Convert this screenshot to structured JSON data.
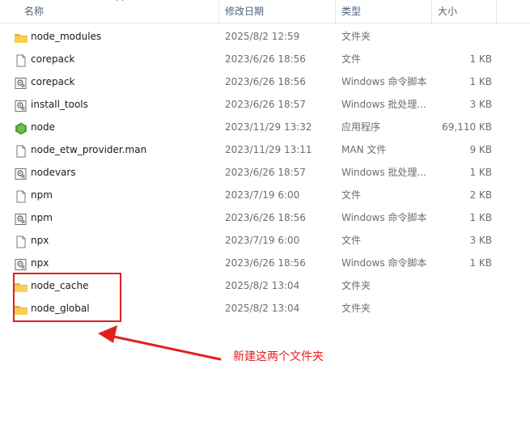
{
  "columns": {
    "name": "名称",
    "date": "修改日期",
    "type": "类型",
    "size": "大小"
  },
  "files": [
    {
      "icon": "folder-icon",
      "name": "node_modules",
      "date": "2025/8/2 12:59",
      "type": "文件夹",
      "size": ""
    },
    {
      "icon": "file-icon",
      "name": "corepack",
      "date": "2023/6/26 18:56",
      "type": "文件",
      "size": "1 KB"
    },
    {
      "icon": "cmd-script-icon",
      "name": "corepack",
      "date": "2023/6/26 18:56",
      "type": "Windows 命令脚本",
      "size": "1 KB"
    },
    {
      "icon": "batch-file-icon",
      "name": "install_tools",
      "date": "2023/6/26 18:57",
      "type": "Windows 批处理...",
      "size": "3 KB"
    },
    {
      "icon": "node-app-icon",
      "name": "node",
      "date": "2023/11/29 13:32",
      "type": "应用程序",
      "size": "69,110 KB"
    },
    {
      "icon": "file-icon",
      "name": "node_etw_provider.man",
      "date": "2023/11/29 13:11",
      "type": "MAN 文件",
      "size": "9 KB"
    },
    {
      "icon": "batch-file-icon",
      "name": "nodevars",
      "date": "2023/6/26 18:57",
      "type": "Windows 批处理...",
      "size": "1 KB"
    },
    {
      "icon": "file-icon",
      "name": "npm",
      "date": "2023/7/19 6:00",
      "type": "文件",
      "size": "2 KB"
    },
    {
      "icon": "cmd-script-icon",
      "name": "npm",
      "date": "2023/6/26 18:56",
      "type": "Windows 命令脚本",
      "size": "1 KB"
    },
    {
      "icon": "file-icon",
      "name": "npx",
      "date": "2023/7/19 6:00",
      "type": "文件",
      "size": "3 KB"
    },
    {
      "icon": "cmd-script-icon",
      "name": "npx",
      "date": "2023/6/26 18:56",
      "type": "Windows 命令脚本",
      "size": "1 KB"
    },
    {
      "icon": "folder-icon",
      "name": "node_cache",
      "date": "2025/8/2 13:04",
      "type": "文件夹",
      "size": ""
    },
    {
      "icon": "folder-icon",
      "name": "node_global",
      "date": "2025/8/2 13:04",
      "type": "文件夹",
      "size": ""
    }
  ],
  "annotation": {
    "text": "新建这两个文件夹",
    "color": "#e02020"
  },
  "colors": {
    "folder": "#f4c54a",
    "node_green": "#539e43",
    "header_text": "#4c607a"
  }
}
